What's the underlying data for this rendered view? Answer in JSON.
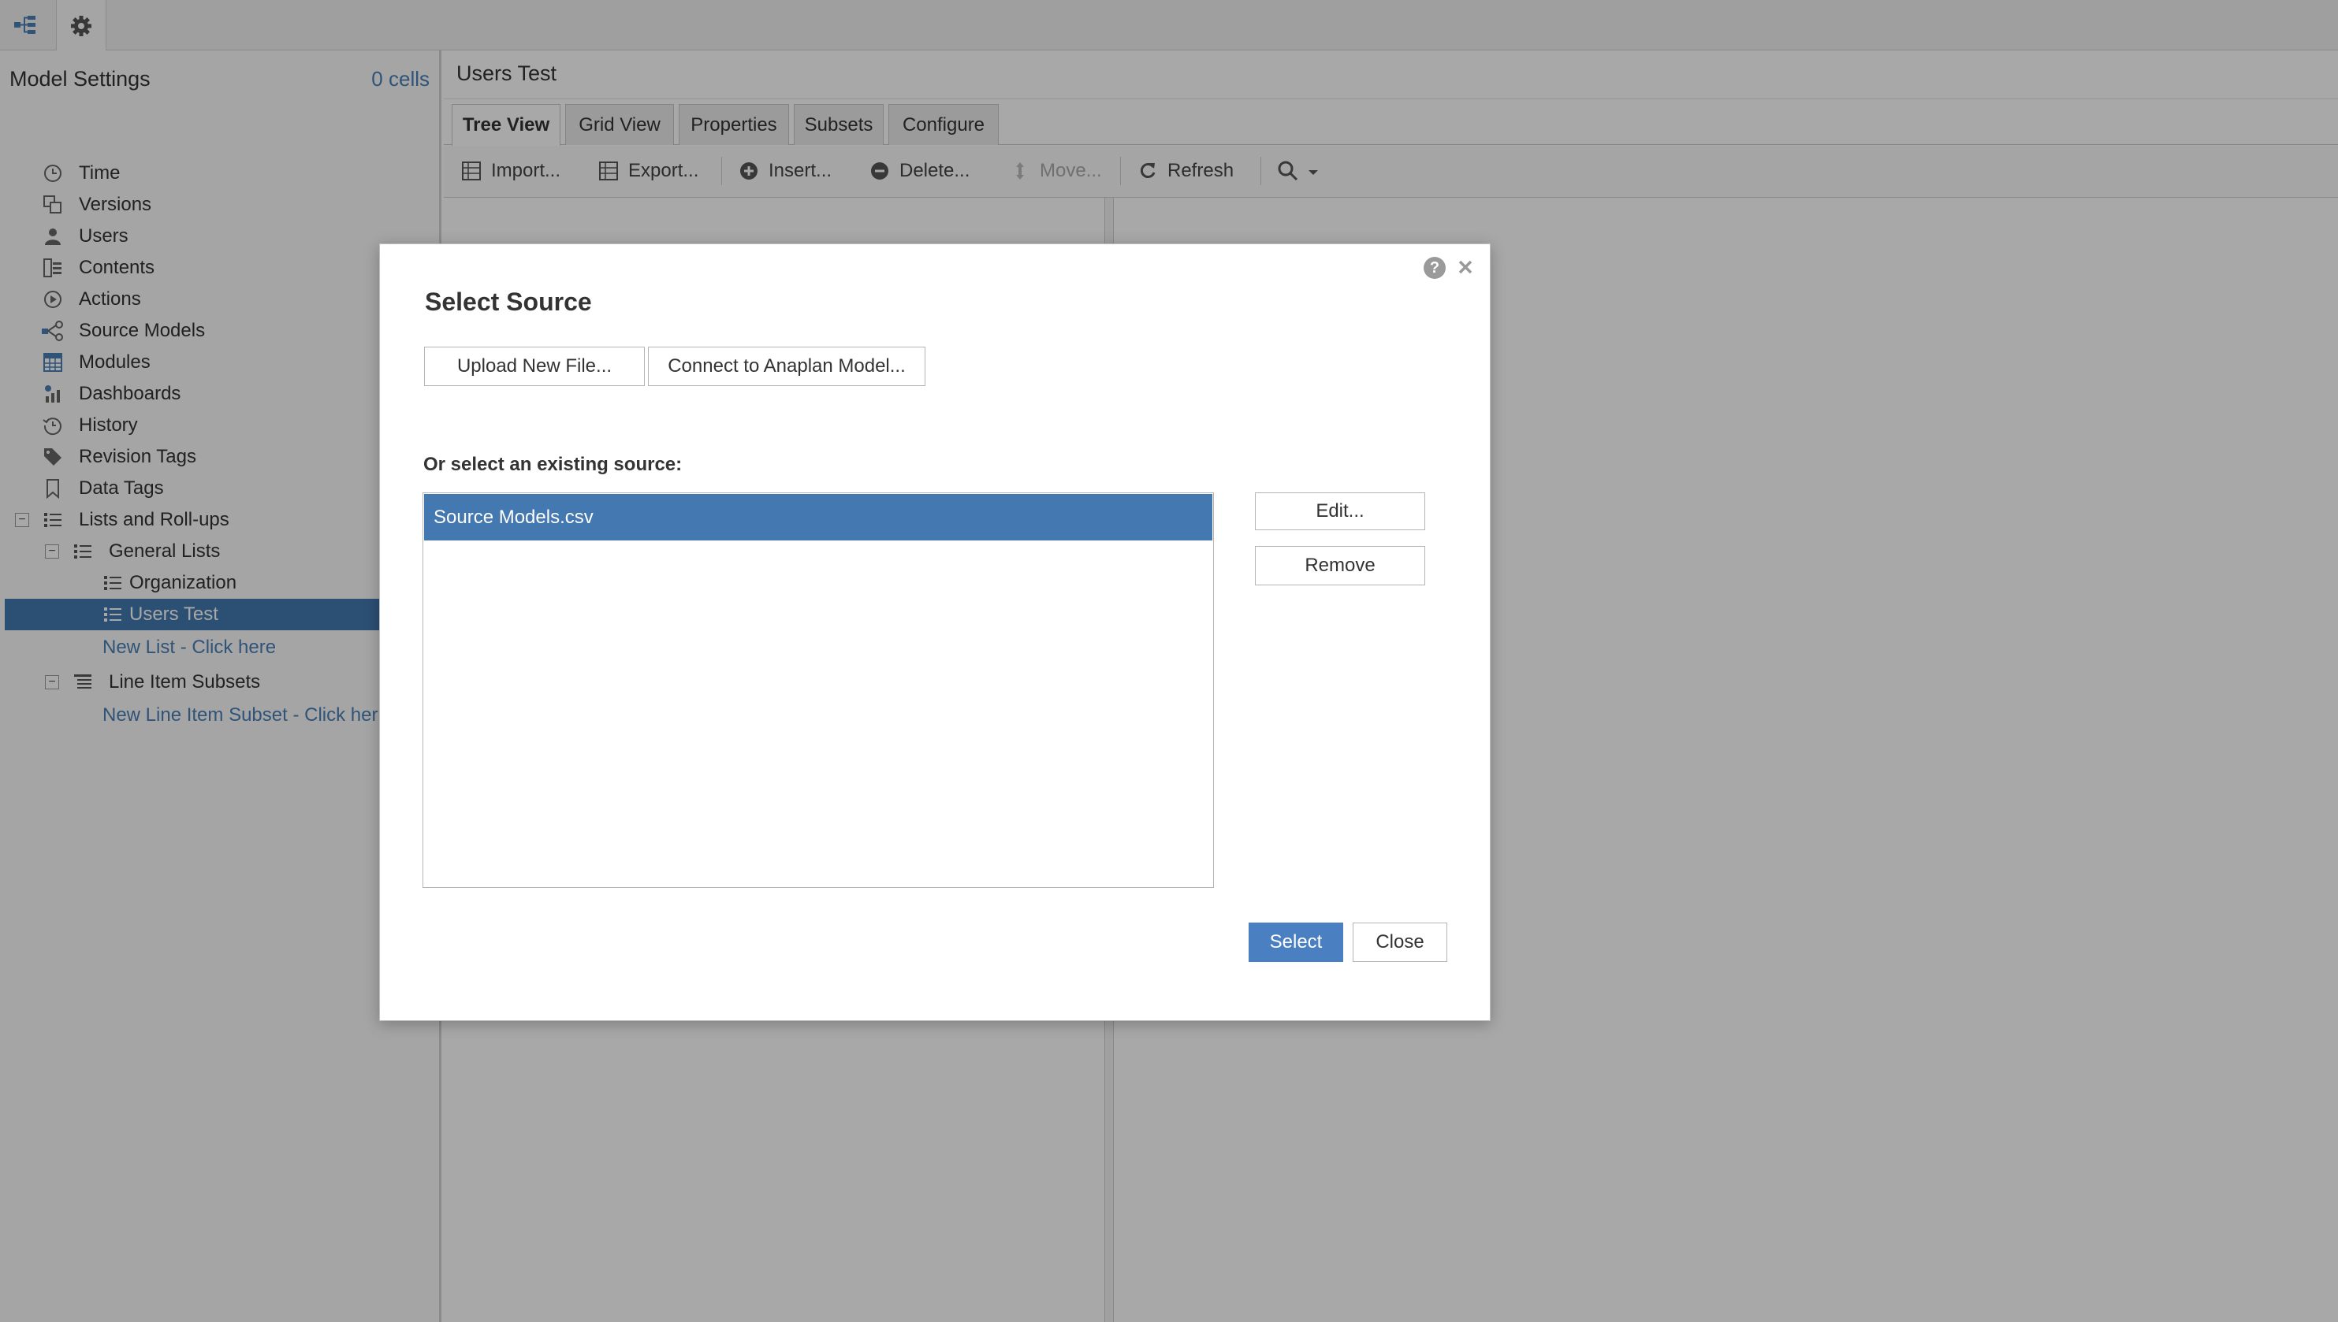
{
  "topbar": {
    "icons": [
      "hierarchy-icon",
      "gear-icon"
    ]
  },
  "sidebar": {
    "title": "Model Settings",
    "cells": "0 cells",
    "items": [
      {
        "label": "Time",
        "icon": "clock-icon"
      },
      {
        "label": "Versions",
        "icon": "versions-icon"
      },
      {
        "label": "Users",
        "icon": "user-icon"
      },
      {
        "label": "Contents",
        "icon": "contents-icon"
      },
      {
        "label": "Actions",
        "icon": "actions-icon"
      },
      {
        "label": "Source Models",
        "icon": "source-models-icon"
      },
      {
        "label": "Modules",
        "icon": "grid-icon"
      },
      {
        "label": "Dashboards",
        "icon": "dashboards-icon"
      },
      {
        "label": "History",
        "icon": "history-icon"
      },
      {
        "label": "Revision Tags",
        "icon": "tag-icon"
      },
      {
        "label": "Data Tags",
        "icon": "bookmark-icon"
      },
      {
        "label": "Lists and Roll-ups",
        "icon": "list-icon"
      },
      {
        "label": "General Lists",
        "icon": "list-icon"
      },
      {
        "label": "Organization",
        "icon": "list-icon"
      },
      {
        "label": "Users Test",
        "icon": "list-icon"
      },
      {
        "label": "New List - Click here",
        "icon": ""
      },
      {
        "label": "Line Item Subsets",
        "icon": "subsets-icon"
      },
      {
        "label": "New Line Item Subset - Click her",
        "icon": ""
      }
    ],
    "selected": "Users Test"
  },
  "main": {
    "title": "Users Test",
    "tabs": [
      "Tree View",
      "Grid View",
      "Properties",
      "Subsets",
      "Configure"
    ],
    "active_tab": "Tree View",
    "toolbar": {
      "import": "Import...",
      "export": "Export...",
      "insert": "Insert...",
      "delete": "Delete...",
      "move": "Move...",
      "refresh": "Refresh"
    }
  },
  "dialog": {
    "title": "Select Source",
    "upload_button": "Upload New File...",
    "connect_button": "Connect to Anaplan Model...",
    "existing_label": "Or select an existing source:",
    "sources": [
      "Source Models.csv"
    ],
    "edit_button": "Edit...",
    "remove_button": "Remove",
    "select_button": "Select",
    "close_button": "Close",
    "help_glyph": "?"
  },
  "colors": {
    "accent": "#4a80c2",
    "selection": "#4379b0",
    "link": "#4a7fb6"
  }
}
